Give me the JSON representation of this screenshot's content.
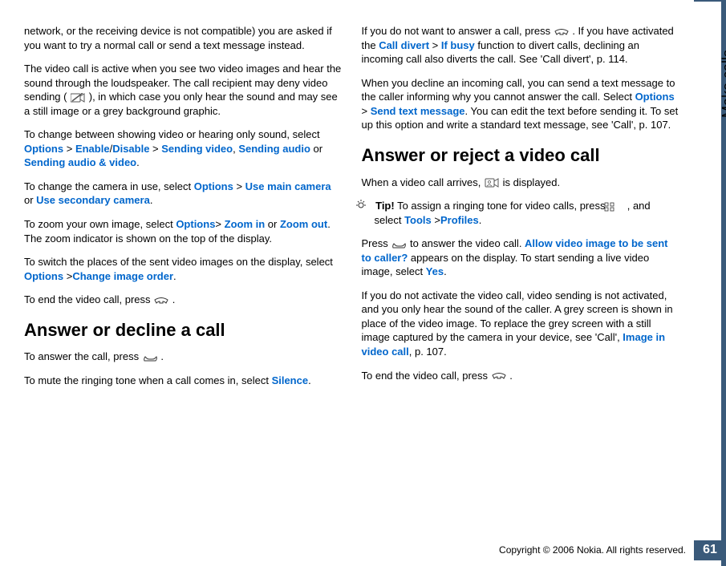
{
  "sideTab": "Make calls",
  "pageNumber": "61",
  "copyright": "Copyright © 2006 Nokia. All rights reserved.",
  "col1": {
    "p1": "network, or the receiving device is not compatible) you are asked if you want to try a normal call or send a text message instead.",
    "p2_a": "The video call is active when you see two video images and hear the sound through the loudspeaker. The call recipient may deny video sending (",
    "p2_b": "), in which case you only hear the sound and may see a still image or a grey background graphic.",
    "p3_a": "To change between showing video or hearing only sound, select ",
    "p3_options": "Options",
    "p3_gt1": " > ",
    "p3_enable": "Enable",
    "p3_slash": "/",
    "p3_disable": "Disable",
    "p3_gt2": " > ",
    "p3_sv": "Sending video",
    "p3_comma": ", ",
    "p3_sa": "Sending audio",
    "p3_or": " or ",
    "p3_sav": "Sending audio & video",
    "p3_dot": ".",
    "p4_a": "To change the camera in use, select ",
    "p4_options": "Options",
    "p4_gt": " > ",
    "p4_main": "Use main camera",
    "p4_or": " or ",
    "p4_sec": "Use secondary camera",
    "p4_dot": ".",
    "p5_a": "To zoom your own image, select ",
    "p5_options": "Options",
    "p5_gt": ">  ",
    "p5_zin": "Zoom in",
    "p5_or": " or ",
    "p5_zout": "Zoom out",
    "p5_b": ". The zoom indicator is shown on the top of the display.",
    "p6_a": "To switch the places of the sent video images on the display, select ",
    "p6_options": "Options",
    "p6_gt": " >",
    "p6_cio": "Change image order",
    "p6_dot": ".",
    "p7_a": "To end the video call, press ",
    "p7_b": " .",
    "h1": "Answer or decline a call",
    "p8_a": "To answer the call, press ",
    "p8_b": " .",
    "p9_a": "To mute the ringing tone when a call comes in, select ",
    "p9_silence": "Silence",
    "p9_dot": "."
  },
  "col2": {
    "p1_a": "If you do not want to answer a call, press ",
    "p1_b": " . If you have activated the ",
    "p1_cd": "Call divert",
    "p1_gt": " > ",
    "p1_ib": "If busy",
    "p1_c": " function to divert calls, declining an incoming call also diverts the call. See 'Call divert', p. 114.",
    "p2_a": "When you decline an incoming call, you can send a text message to the caller informing why you cannot answer the call. Select ",
    "p2_options": "Options",
    "p2_gt": " > ",
    "p2_stm": "Send text message",
    "p2_b": ". You can edit the text before sending it. To set up this option and write a standard text message, see 'Call', p. 107.",
    "h1": "Answer or reject a video call",
    "p3_a": "When a video call arrives, ",
    "p3_b": " is displayed.",
    "tip_label": " Tip!",
    "tip_a": " To assign a ringing tone for video calls, press ",
    "tip_b": " , and select ",
    "tip_tools": "Tools",
    "tip_gt": " >",
    "tip_profiles": "Profiles",
    "tip_dot": ".",
    "p4_a": "Press ",
    "p4_b": " to answer the video call. ",
    "p4_allow": "Allow video image to be sent to caller?",
    "p4_c": " appears on the display. To start sending a live video image, select ",
    "p4_yes": "Yes",
    "p4_dot": ".",
    "p5_a": "If you do not activate the video call, video sending is not activated, and you only hear the sound of the caller. A grey screen is shown in place of the video image. To replace the grey screen with a still image captured by the camera in your device, see 'Call', ",
    "p5_ivc": "Image in video call",
    "p5_b": ", p. 107.",
    "p6_a": "To end the video call, press ",
    "p6_b": " ."
  }
}
